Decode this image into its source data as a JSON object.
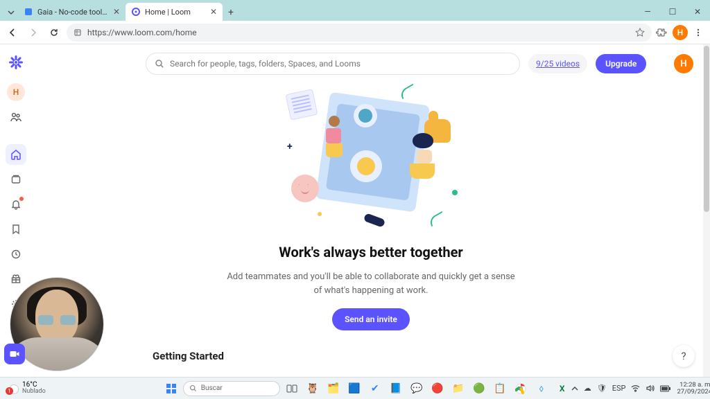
{
  "browser": {
    "tabs": [
      {
        "title": "Gaia - No-code tool to build N…",
        "active": false
      },
      {
        "title": "Home | Loom",
        "active": true
      }
    ],
    "url": "https://www.loom.com/home"
  },
  "header": {
    "search_placeholder": "Search for people, tags, folders, Spaces, and Looms",
    "video_count": "9/25 videos",
    "upgrade_label": "Upgrade",
    "avatar_initial": "H"
  },
  "sidebar": {
    "avatar_initial": "H"
  },
  "hero": {
    "title": "Work's always better together",
    "subtitle": "Add teammates and you'll be able to collaborate and quickly get a sense of what's happening at work.",
    "cta_label": "Send an invite"
  },
  "section": {
    "getting_started": "Getting Started"
  },
  "help": {
    "label": "?"
  },
  "taskbar": {
    "weather_badge": "1",
    "temperature": "16°C",
    "condition": "Nublado",
    "search_placeholder": "Buscar",
    "lang": "ESP",
    "time": "12:28 a. m.",
    "date": "27/09/2024"
  }
}
